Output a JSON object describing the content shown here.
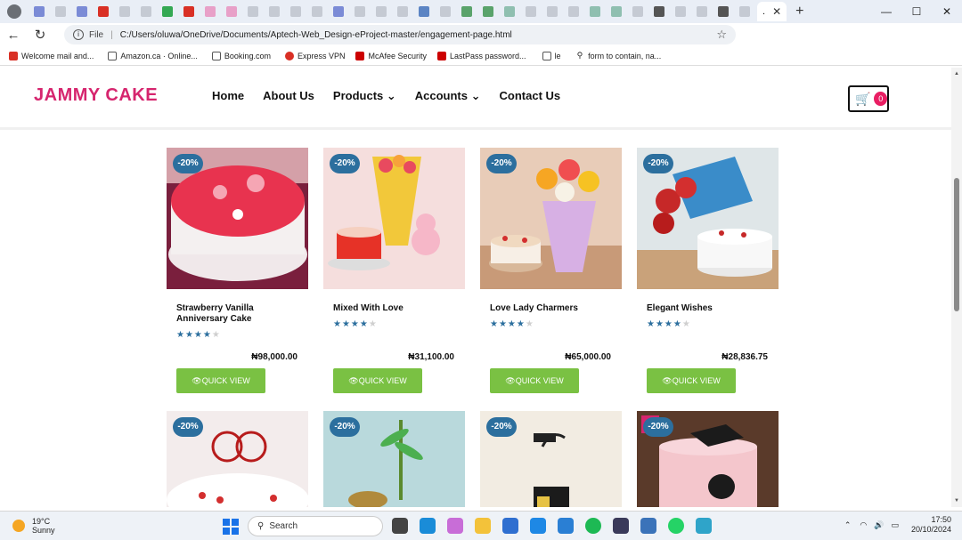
{
  "browser": {
    "active_tab_title": ".",
    "address": "C:/Users/oluwa/OneDrive/Documents/Aptech-Web_Design-eProject-master/engagement-page.html",
    "address_prefix": "File",
    "bookmarks": [
      "Welcome mail and...",
      "Amazon.ca · Online...",
      "Booking.com",
      "Express VPN",
      "McAfee Security",
      "LastPass password...",
      "le",
      "form to contain, na..."
    ],
    "bookmark_colors": [
      "#d93025",
      "#555",
      "#555",
      "#d93025",
      "#c00",
      "#c00",
      "#555",
      "#555"
    ]
  },
  "site": {
    "logo": "JAMMY CAKE",
    "nav": [
      "Home",
      "About Us",
      "Products",
      "Accounts",
      "Contact Us"
    ],
    "cart_count": "0"
  },
  "products": [
    {
      "name": "Strawberry Vanilla Anniversary Cake",
      "rating": 4,
      "price": "₦98,000.00",
      "discount": "-20%",
      "button": "QUICK VIEW"
    },
    {
      "name": "Mixed With Love",
      "rating": 4,
      "price": "₦31,100.00",
      "discount": "-20%",
      "button": "QUICK VIEW"
    },
    {
      "name": "Love Lady Charmers",
      "rating": 4,
      "price": "₦65,000.00",
      "discount": "-20%",
      "button": "QUICK VIEW"
    },
    {
      "name": "Elegant Wishes",
      "rating": 4,
      "price": "₦28,836.75",
      "discount": "-20%",
      "button": "QUICK VIEW"
    }
  ],
  "products_row2": [
    {
      "discount": "-20%"
    },
    {
      "discount": "-20%"
    },
    {
      "discount": "-20%"
    },
    {
      "discount": "-20%"
    }
  ],
  "taskbar": {
    "temperature": "19°C",
    "weather": "Sunny",
    "search": "Search",
    "time": "17:50",
    "date": "20/10/2024"
  }
}
